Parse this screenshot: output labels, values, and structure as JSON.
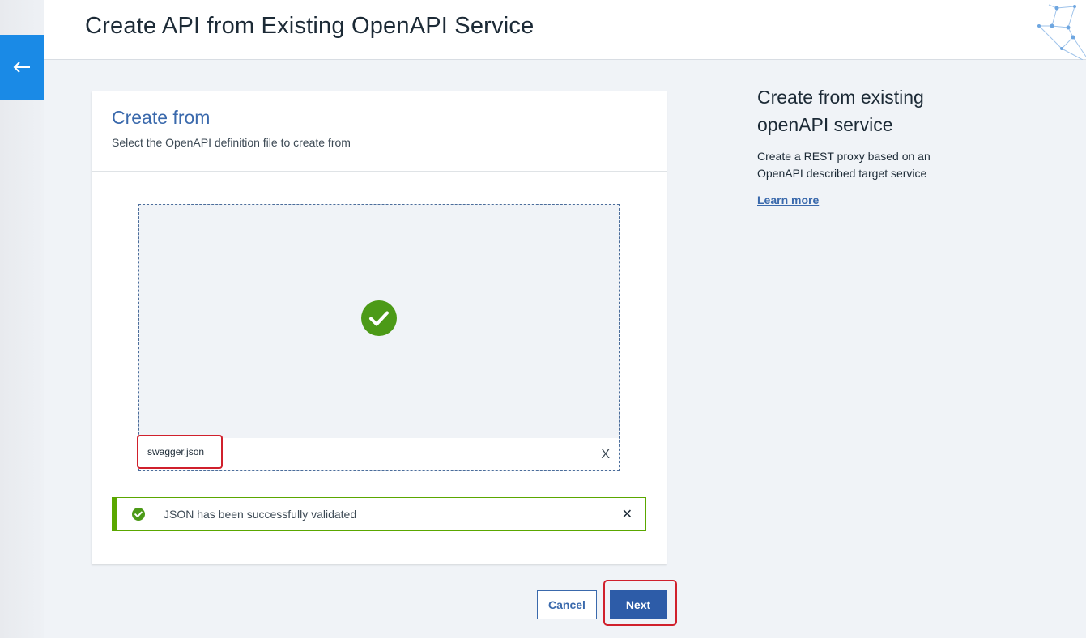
{
  "header": {
    "title": "Create API from Existing OpenAPI Service",
    "back_icon": "arrow-left-icon"
  },
  "card": {
    "title": "Create from",
    "subtitle": "Select the OpenAPI definition file to create from",
    "dropzone": {
      "status_icon": "checkmark-circle-icon",
      "file_name": "swagger.json",
      "remove_label": "X"
    },
    "notification": {
      "text": "JSON has been successfully validated",
      "icon": "checkmark-circle-icon",
      "close_label": "✕",
      "status_color": "#5aa700"
    }
  },
  "actions": {
    "cancel_label": "Cancel",
    "next_label": "Next"
  },
  "side_panel": {
    "title": "Create from existing openAPI service",
    "description": "Create a REST proxy based on an OpenAPI described target service",
    "link": "Learn more"
  },
  "colors": {
    "accent": "#3a69ac",
    "back_button": "#1a8ae6",
    "primary_button": "#2d5ca8",
    "success": "#4c9a17",
    "highlight": "#d0202c"
  }
}
